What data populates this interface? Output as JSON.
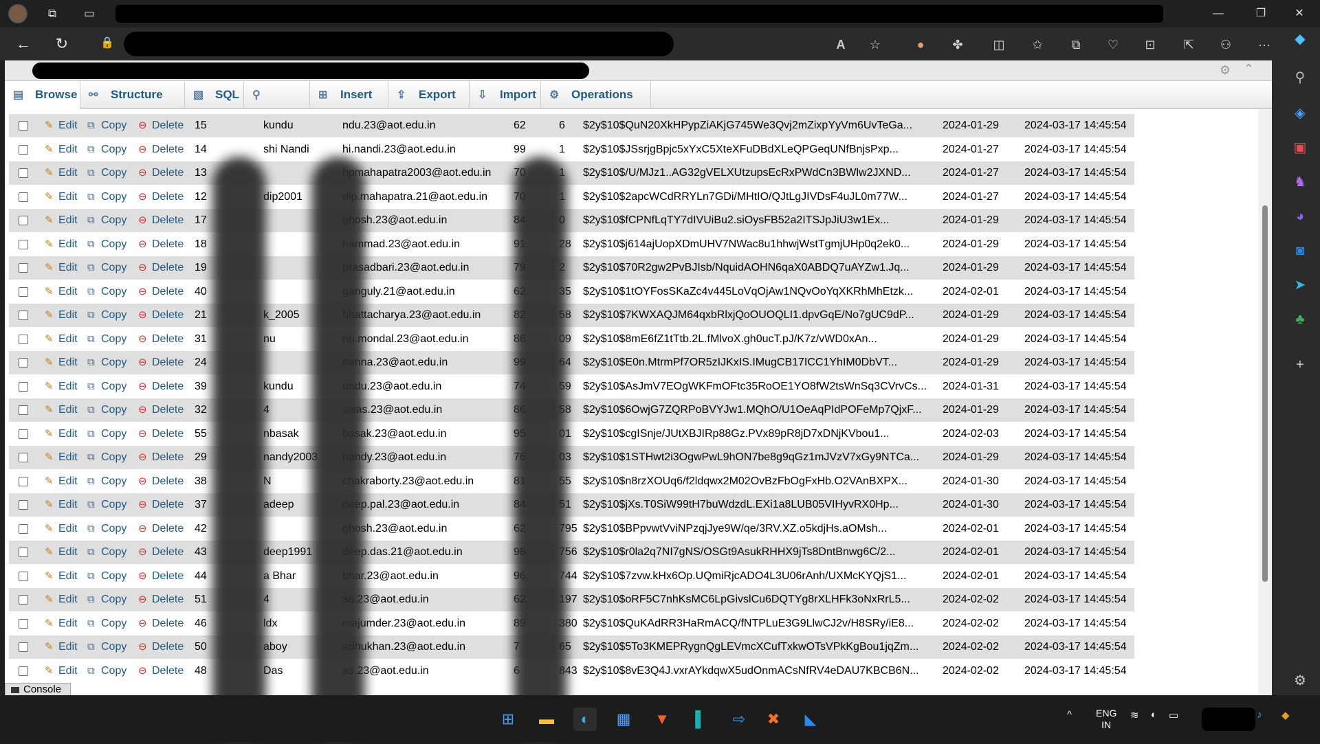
{
  "browser": {
    "buttons": {
      "back": "←",
      "refresh": "↻",
      "lock": "🔒",
      "read_aloud": "A",
      "favorite": "☆",
      "extensions": "⧉",
      "split": "◫",
      "favorites": "✩",
      "collections": "⧉",
      "more": "···"
    },
    "window": {
      "minimize": "—",
      "maximize": "❐",
      "close": "✕"
    }
  },
  "pma": {
    "tabs": [
      {
        "label": "Browse",
        "icon": "browse-icon",
        "glyph": "▤"
      },
      {
        "label": "Structure",
        "icon": "structure-icon",
        "glyph": "⚯"
      },
      {
        "label": "SQL",
        "icon": "sql-icon",
        "glyph": "▧"
      },
      {
        "label": "Search",
        "icon": "search-icon",
        "glyph": "⚲"
      },
      {
        "label": "Insert",
        "icon": "insert-icon",
        "glyph": "⊞"
      },
      {
        "label": "Export",
        "icon": "export-icon",
        "glyph": "⇪"
      },
      {
        "label": "Import",
        "icon": "import-icon",
        "glyph": "⇩"
      },
      {
        "label": "Operations",
        "icon": "operations-icon",
        "glyph": "⚙"
      }
    ],
    "actions": {
      "edit": "Edit",
      "copy": "Copy",
      "delete": "Delete"
    },
    "console_label": "Console",
    "rows": [
      {
        "id": "15",
        "name": "kundu",
        "email": "ndu.23@aot.edu.in",
        "phone_a": "62",
        "phone_b": "6",
        "hash": "$2y$10$QuN20XkHPypZiAKjG745We3Qvj2mZixpYyVm6UvTeGa...",
        "created": "2024-01-29",
        "updated": "2024-03-17 14:45:54"
      },
      {
        "id": "14",
        "name": "shi Nandi",
        "email": "hi.nandi.23@aot.edu.in",
        "phone_a": "99",
        "phone_b": "1",
        "hash": "$2y$10$JSsrjgBpjc5xYxC5XteXFuDBdXLeQPGeqUNfBnjsPxp...",
        "created": "2024-01-27",
        "updated": "2024-03-17 14:45:54"
      },
      {
        "id": "13",
        "name": "",
        "email": "hpmahapatra2003@aot.edu.in",
        "phone_a": "70",
        "phone_b": "1",
        "hash": "$2y$10$/U/MJz1..AG32gVELXUtzupsEcRxPWdCn3BWlw2JXND...",
        "created": "2024-01-27",
        "updated": "2024-03-17 14:45:54"
      },
      {
        "id": "12",
        "name": "dip2001",
        "email": "dip.mahapatra.21@aot.edu.in",
        "phone_a": "70",
        "phone_b": "1",
        "hash": "$2y$10$2apcWCdRRYLn7GDi/MHtIO/QJtLgJIVDsF4uJL0m77W...",
        "created": "2024-01-27",
        "updated": "2024-03-17 14:45:54"
      },
      {
        "id": "17",
        "name": "",
        "email": "ghosh.23@aot.edu.in",
        "phone_a": "84",
        "phone_b": "0",
        "hash": "$2y$10$fCPNfLqTY7dIVUiBu2.siOysFB52a2ITSJpJiU3w1Ex...",
        "created": "2024-01-29",
        "updated": "2024-03-17 14:45:54"
      },
      {
        "id": "18",
        "name": "",
        "email": "hammad.23@aot.edu.in",
        "phone_a": "91",
        "phone_b": "28",
        "hash": "$2y$10$j614ajUopXDmUHV7NWac8u1hhwjWstTgmjUHp0q2ek0...",
        "created": "2024-01-29",
        "updated": "2024-03-17 14:45:54"
      },
      {
        "id": "19",
        "name": "",
        "email": "prasadbari.23@aot.edu.in",
        "phone_a": "79",
        "phone_b": "2",
        "hash": "$2y$10$70R2gw2PvBJIsb/NquidAOHN6qaX0ABDQ7uAYZw1.Jq...",
        "created": "2024-01-29",
        "updated": "2024-03-17 14:45:54"
      },
      {
        "id": "40",
        "name": "",
        "email": "ganguly.21@aot.edu.in",
        "phone_a": "62",
        "phone_b": "35",
        "hash": "$2y$10$1tOYFosSKaZc4v445LoVqOjAw1NQvOoYqXKRhMhEtzk...",
        "created": "2024-02-01",
        "updated": "2024-03-17 14:45:54"
      },
      {
        "id": "21",
        "name": "k_2005",
        "email": "bhattacharya.23@aot.edu.in",
        "phone_a": "82",
        "phone_b": "58",
        "hash": "$2y$10$7KWXAQJM64qxbRlxjQoOUOQLI1.dpvGqE/No7gUC9dP...",
        "created": "2024-01-29",
        "updated": "2024-03-17 14:45:54"
      },
      {
        "id": "31",
        "name": "nu",
        "email": "nu.mondal.23@aot.edu.in",
        "phone_a": "86",
        "phone_b": "09",
        "hash": "$2y$10$8mE6fZ1tTtb.2L.fMlvoX.gh0ucT.pJ/K7z/vWD0xAn...",
        "created": "2024-01-29",
        "updated": "2024-03-17 14:45:54"
      },
      {
        "id": "24",
        "name": "",
        "email": "nanna.23@aot.edu.in",
        "phone_a": "99",
        "phone_b": "64",
        "hash": "$2y$10$E0n.MtrmPf7OR5zIJKxIS.IMugCB17ICC1YhIM0DbVT...",
        "created": "2024-01-29",
        "updated": "2024-03-17 14:45:54"
      },
      {
        "id": "39",
        "name": "kundu",
        "email": "undu.23@aot.edu.in",
        "phone_a": "74",
        "phone_b": "59",
        "hash": "$2y$10$AsJmV7EOgWKFmOFtc35RoOE1YO8fW2tsWnSq3CVrvCs...",
        "created": "2024-01-31",
        "updated": "2024-03-17 14:45:54"
      },
      {
        "id": "32",
        "name": "4",
        "email": "swas.23@aot.edu.in",
        "phone_a": "86",
        "phone_b": "58",
        "hash": "$2y$10$6OwjG7ZQRPoBVYJw1.MQhO/U1OeAqPIdPOFeMp7QjxF...",
        "created": "2024-01-29",
        "updated": "2024-03-17 14:45:54"
      },
      {
        "id": "55",
        "name": "nbasak",
        "email": "basak.23@aot.edu.in",
        "phone_a": "95",
        "phone_b": "01",
        "hash": "$2y$10$cgISnje/JUtXBJIRp88Gz.PVx89pR8jD7xDNjKVbou1...",
        "created": "2024-02-03",
        "updated": "2024-03-17 14:45:54"
      },
      {
        "id": "29",
        "name": "nandy2003",
        "email": "nandy.23@aot.edu.in",
        "phone_a": "76",
        "phone_b": "03",
        "hash": "$2y$10$1STHwt2i3OgwPwL9hON7be8g9qGz1mJVzV7xGy9NTCa...",
        "created": "2024-01-29",
        "updated": "2024-03-17 14:45:54"
      },
      {
        "id": "38",
        "name": "N",
        "email": "chakraborty.23@aot.edu.in",
        "phone_a": "81",
        "phone_b": "55",
        "hash": "$2y$10$n8rzXOUq6/f2ldqwx2M02OvBzFbOgFxHb.O2VAnBXPX...",
        "created": "2024-01-30",
        "updated": "2024-03-17 14:45:54"
      },
      {
        "id": "37",
        "name": "adeep",
        "email": "deep.pal.23@aot.edu.in",
        "phone_a": "84",
        "phone_b": "51",
        "hash": "$2y$10$jXs.T0SiW99tH7buWdzdL.EXi1a8LUB05VIHyvRX0Hp...",
        "created": "2024-01-30",
        "updated": "2024-03-17 14:45:54"
      },
      {
        "id": "42",
        "name": "",
        "email": "ghosh.23@aot.edu.in",
        "phone_a": "62",
        "phone_b": "795",
        "hash": "$2y$10$BPpvwtVviNPzqjJye9W/qe/3RV.XZ.o5kdjHs.aOMsh...",
        "created": "2024-02-01",
        "updated": "2024-03-17 14:45:54"
      },
      {
        "id": "43",
        "name": "deep1991",
        "email": "deep.das.21@aot.edu.in",
        "phone_a": "98",
        "phone_b": "756",
        "hash": "$2y$10$r0la2q7NI7gNS/OSGt9AsukRHHX9jTs8DntBnwg6C/2...",
        "created": "2024-02-01",
        "updated": "2024-03-17 14:45:54"
      },
      {
        "id": "44",
        "name": "a Bhar",
        "email": "bhar.23@aot.edu.in",
        "phone_a": "96",
        "phone_b": "744",
        "hash": "$2y$10$7zvw.kHx6Op.UQmiRjcADO4L3U06rAnh/UXMcKYQjS1...",
        "created": "2024-02-01",
        "updated": "2024-03-17 14:45:54"
      },
      {
        "id": "51",
        "name": "4",
        "email": "as.23@aot.edu.in",
        "phone_a": "62",
        "phone_b": "197",
        "hash": "$2y$10$oRF5C7nhKsMC6LpGivslCu6DQTYg8rXLHFk3oNxRrL5...",
        "created": "2024-02-02",
        "updated": "2024-03-17 14:45:54"
      },
      {
        "id": "46",
        "name": "ldx",
        "email": "majumder.23@aot.edu.in",
        "phone_a": "89",
        "phone_b": "380",
        "hash": "$2y$10$QuKAdRR3HaRmACQ/fNTPLuE3G9LlwCJ2v/H8SRy/iE8...",
        "created": "2024-02-02",
        "updated": "2024-03-17 14:45:54"
      },
      {
        "id": "50",
        "name": "aboy",
        "email": "adhukhan.23@aot.edu.in",
        "phone_a": "7",
        "phone_b": "65",
        "hash": "$2y$10$5To3KMEPRygnQgLEVmcXCufTxkwOTsVPkKgBou1jqZm...",
        "created": "2024-02-02",
        "updated": "2024-03-17 14:45:54"
      },
      {
        "id": "48",
        "name": "Das",
        "email": "as.23@aot.edu.in",
        "phone_a": "6",
        "phone_b": "843",
        "hash": "$2y$10$8vE3Q4J.vxrAYkdqwX5udOnmACsNfRV4eDAU7KBCB6N...",
        "created": "2024-02-02",
        "updated": "2024-03-17 14:45:54"
      }
    ]
  },
  "taskbar": {
    "lang_top": "ENG",
    "lang_bottom": "IN",
    "tray_chevron": "^"
  }
}
